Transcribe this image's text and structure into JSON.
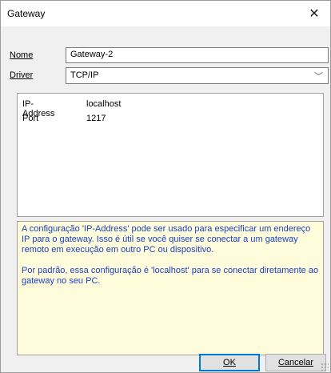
{
  "window": {
    "title": "Gateway",
    "close_icon": "close-icon"
  },
  "form": {
    "name_label": "Nome",
    "name_value": "Gateway-2",
    "driver_label": "Driver",
    "driver_value": "TCP/IP"
  },
  "properties": [
    {
      "name": "IP-Address",
      "value": "localhost"
    },
    {
      "name": "Port",
      "value": "1217"
    }
  ],
  "help": {
    "paragraph1": "A configuração 'IP-Address' pode ser usado para especificar um endereço IP para o gateway. Isso é útil se você quiser se conectar a um gateway remoto em execução em outro PC ou dispositivo.",
    "paragraph2": "Por padrão, essa configuração é 'localhost' para se conectar diretamente ao gateway no seu PC."
  },
  "buttons": {
    "ok_label": "OK",
    "cancel_label": "Cancelar"
  },
  "colors": {
    "help_bg": "#fffcdc",
    "help_text": "#1a3fbf",
    "accent": "#0078d7"
  }
}
